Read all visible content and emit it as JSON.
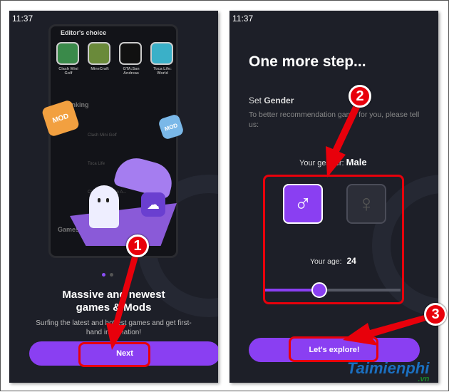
{
  "left": {
    "time": "11:37",
    "preview": {
      "title": "Editor's choice",
      "apps": [
        {
          "name": "Clash Mini Golf",
          "color": "#3a8a4a"
        },
        {
          "name": "MineCraft",
          "color": "#6a8a3a"
        },
        {
          "name": "GTA:San Andreas",
          "color": "#111111"
        },
        {
          "name": "Toca Life: World",
          "color": "#3ab0c8"
        }
      ],
      "section": "Ranking",
      "rows": [
        "Clash Mini Golf",
        "Toca Life",
        "Clash ... nter the A..."
      ],
      "section2": "Games"
    },
    "gift_label": "MOD",
    "headline": "Massive and newest games & Mods",
    "subtext": "Surfing the latest and hottest games and get first-hand information!",
    "next_label": "Next",
    "page_index": 1,
    "page_count": 2
  },
  "right": {
    "time": "11:37",
    "headline": "One more step...",
    "set_prefix": "Set ",
    "set_bold": "Gender",
    "hint": "To better recommendation game for you, please tell us:",
    "gender_label": "Your gender:",
    "gender_value": "Male",
    "male_icon": "♂",
    "female_icon": "♀",
    "age_label": "Your age:",
    "age_value": "24",
    "age_slider_fraction": 0.4,
    "explore_label": "Let's explore!"
  },
  "annotations": [
    "1",
    "2",
    "3"
  ],
  "watermark": {
    "text": "Taimienphi",
    "suffix": ".vn"
  },
  "colors": {
    "accent": "#8a3ff2",
    "background": "#1d1f28",
    "annotation": "#e8000b"
  }
}
